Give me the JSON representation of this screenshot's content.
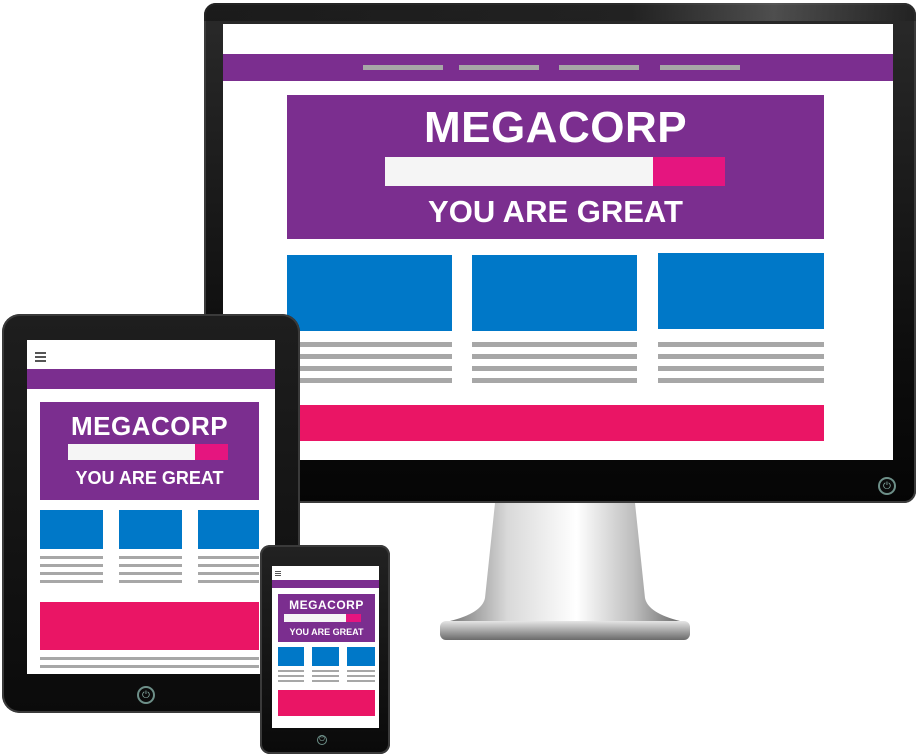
{
  "brand": {
    "name": "MEGACORP",
    "tagline": "YOU ARE GREAT"
  },
  "colors": {
    "purple": "#7b2e8f",
    "pink": "#e5157f",
    "cta_pink": "#ea1565",
    "blue": "#0078c8",
    "gray_lines": "#a7a7a7"
  },
  "icons": {
    "menu": "hamburger-menu-icon",
    "power": "power-icon"
  },
  "devices": [
    "desktop-monitor",
    "tablet",
    "phone"
  ]
}
